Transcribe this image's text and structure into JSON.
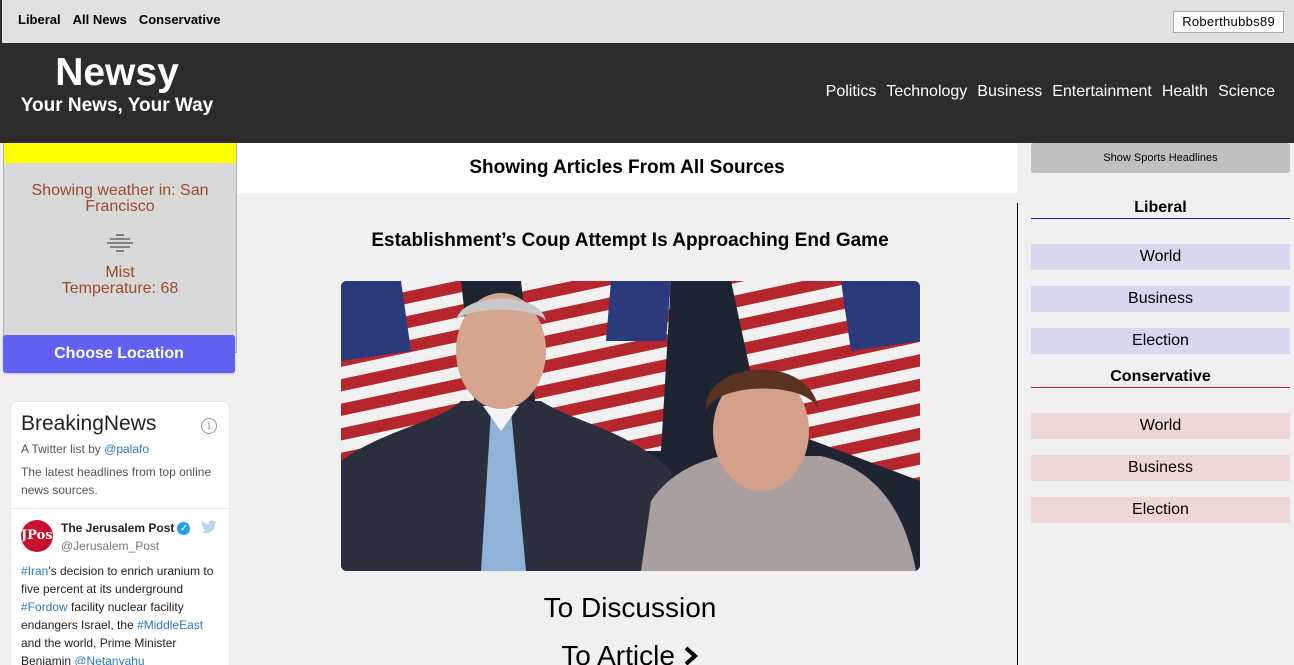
{
  "topbar": {
    "filters": [
      "Liberal",
      "All News",
      "Conservative"
    ],
    "username": "Roberthubbs89"
  },
  "header": {
    "logo": "Newsy",
    "tagline": "Your News, Your Way",
    "nav": [
      "Politics",
      "Technology",
      "Business",
      "Entertainment",
      "Health",
      "Science"
    ]
  },
  "weather": {
    "location_text": "Showing weather in: San Francisco",
    "icon": "mist-icon",
    "condition": "Mist",
    "temperature_text": "Temperature: 68",
    "choose_location_label": "Choose Location"
  },
  "twitter": {
    "title": "BreakingNews",
    "byline_prefix": "A Twitter list by ",
    "byline_handle": "@palafo",
    "description": "The latest headlines from top online news sources.",
    "tweet": {
      "avatar_text": "JPost",
      "account_name": "The Jerusalem Post",
      "handle": "@Jerusalem_Post",
      "parts": [
        {
          "text": "#Iran",
          "tag": true
        },
        {
          "text": "'s decision to enrich uranium to five percent at its underground ",
          "tag": false
        },
        {
          "text": "#Fordow",
          "tag": true
        },
        {
          "text": " facility nuclear facility endangers Israel, the ",
          "tag": false
        },
        {
          "text": "#MiddleEast",
          "tag": true
        },
        {
          "text": " and the world, Prime Minister Benjamin ",
          "tag": false
        },
        {
          "text": "@Netanyahu",
          "tag": true
        }
      ]
    }
  },
  "main": {
    "showing_label": "Showing Articles From All Sources",
    "article_title": "Establishment’s Coup Attempt Is Approaching End Game",
    "to_discussion": "To Discussion",
    "to_article": "To Article"
  },
  "sidebar": {
    "sports_button": "Show Sports Headlines",
    "liberal_heading": "Liberal",
    "liberal_categories": [
      "World",
      "Business",
      "Election"
    ],
    "conservative_heading": "Conservative",
    "conservative_categories": [
      "World",
      "Business",
      "Election"
    ]
  },
  "colors": {
    "header_bg": "#2c2c2c",
    "choose_button": "#6161f1",
    "weather_text": "#9b4a2c",
    "liberal_bg": "#d7d7ef",
    "conservative_bg": "#f0d7d7",
    "highlight_yellow": "#ffff00"
  }
}
